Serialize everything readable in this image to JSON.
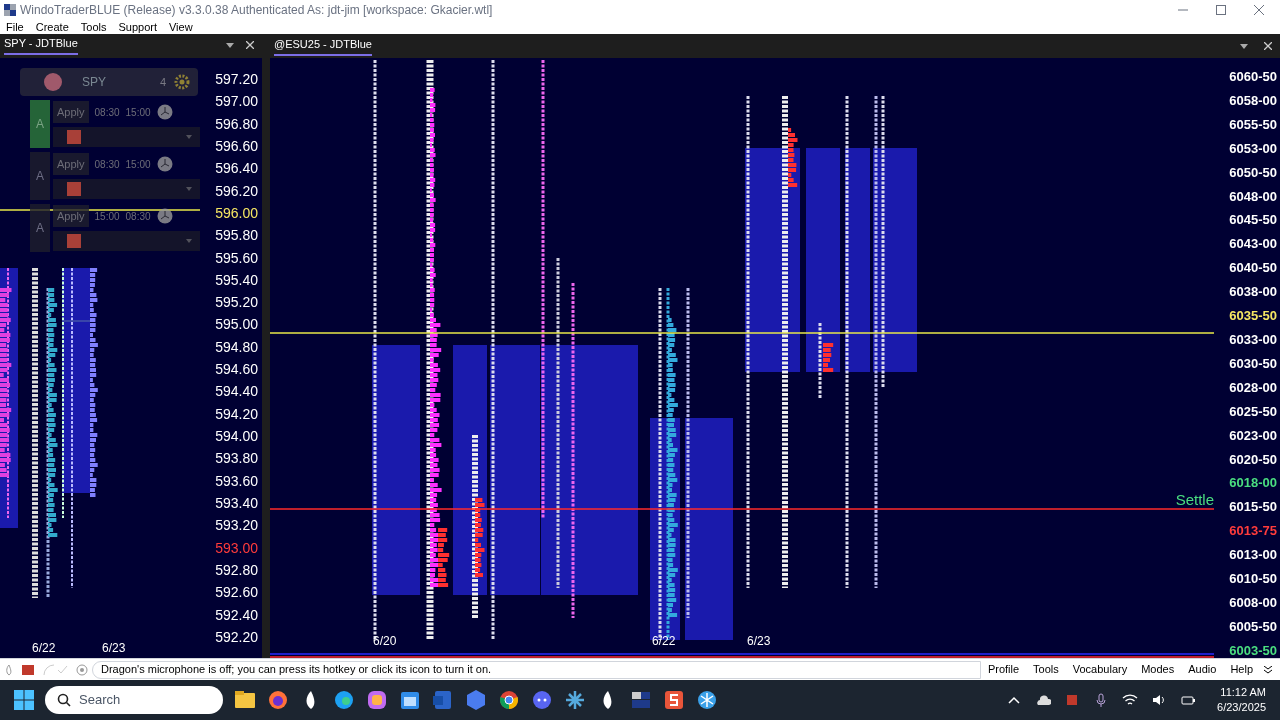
{
  "window": {
    "title": "WindoTraderBLUE (Release) v3.3.0.38 Authenticated As: jdt-jim [workspace: Gkacier.wtl]"
  },
  "menu": [
    "File",
    "Create",
    "Tools",
    "Support",
    "View"
  ],
  "left_panel": {
    "title": "SPY - JDTBlue",
    "controls": {
      "symbol": "SPY",
      "count": "4",
      "rows": [
        {
          "letter": "A",
          "selected": true,
          "apply": "Apply",
          "start": "08:30",
          "end": "15:00"
        },
        {
          "letter": "A",
          "selected": false,
          "apply": "Apply",
          "start": "08:30",
          "end": "15:00"
        },
        {
          "letter": "A",
          "selected": false,
          "apply": "Apply",
          "start": "15:00",
          "end": "08:30"
        }
      ]
    },
    "price_axis": [
      {
        "label": "597.20",
        "color": "#ffffff"
      },
      {
        "label": "597.00",
        "color": "#ffffff"
      },
      {
        "label": "596.80",
        "color": "#ffffff"
      },
      {
        "label": "596.60",
        "color": "#ffffff"
      },
      {
        "label": "596.40",
        "color": "#ffffff"
      },
      {
        "label": "596.20",
        "color": "#ffffff"
      },
      {
        "label": "596.00",
        "color": "#f5e663"
      },
      {
        "label": "595.80",
        "color": "#ffffff"
      },
      {
        "label": "595.60",
        "color": "#ffffff"
      },
      {
        "label": "595.40",
        "color": "#ffffff"
      },
      {
        "label": "595.20",
        "color": "#ffffff"
      },
      {
        "label": "595.00",
        "color": "#ffffff"
      },
      {
        "label": "594.80",
        "color": "#ffffff"
      },
      {
        "label": "594.60",
        "color": "#ffffff"
      },
      {
        "label": "594.40",
        "color": "#ffffff"
      },
      {
        "label": "594.20",
        "color": "#ffffff"
      },
      {
        "label": "594.00",
        "color": "#ffffff"
      },
      {
        "label": "593.80",
        "color": "#ffffff"
      },
      {
        "label": "593.60",
        "color": "#ffffff"
      },
      {
        "label": "593.40",
        "color": "#ffffff"
      },
      {
        "label": "593.20",
        "color": "#ffffff"
      },
      {
        "label": "593.00",
        "color": "#ff3b3b"
      },
      {
        "label": "592.80",
        "color": "#ffffff"
      },
      {
        "label": "592.60",
        "color": "#ffffff"
      },
      {
        "label": "592.40",
        "color": "#ffffff"
      },
      {
        "label": "592.20",
        "color": "#ffffff"
      }
    ],
    "dates": [
      "6/22",
      "6/23"
    ]
  },
  "right_panel": {
    "title": "@ESU25 - JDTBlue",
    "settle_label": "Settle",
    "price_axis": [
      {
        "label": "6060-50",
        "color": "#ffffff"
      },
      {
        "label": "6058-00",
        "color": "#ffffff"
      },
      {
        "label": "6055-50",
        "color": "#ffffff"
      },
      {
        "label": "6053-00",
        "color": "#ffffff"
      },
      {
        "label": "6050-50",
        "color": "#ffffff"
      },
      {
        "label": "6048-00",
        "color": "#ffffff"
      },
      {
        "label": "6045-50",
        "color": "#ffffff"
      },
      {
        "label": "6043-00",
        "color": "#ffffff"
      },
      {
        "label": "6040-50",
        "color": "#ffffff"
      },
      {
        "label": "6038-00",
        "color": "#ffffff"
      },
      {
        "label": "6035-50",
        "color": "#f5e663"
      },
      {
        "label": "6033-00",
        "color": "#ffffff"
      },
      {
        "label": "6030-50",
        "color": "#ffffff"
      },
      {
        "label": "6028-00",
        "color": "#ffffff"
      },
      {
        "label": "6025-50",
        "color": "#ffffff"
      },
      {
        "label": "6023-00",
        "color": "#ffffff"
      },
      {
        "label": "6020-50",
        "color": "#ffffff"
      },
      {
        "label": "6018-00",
        "color": "#4ade80"
      },
      {
        "label": "6015-50",
        "color": "#ffffff"
      },
      {
        "label": "6013-75",
        "color": "#ff3b3b"
      },
      {
        "label": "6013-00",
        "color": "#ffffff"
      },
      {
        "label": "6010-50",
        "color": "#ffffff"
      },
      {
        "label": "6008-00",
        "color": "#ffffff"
      },
      {
        "label": "6005-50",
        "color": "#ffffff"
      },
      {
        "label": "6003-50",
        "color": "#4ade80"
      }
    ],
    "dates": [
      "6/20",
      "6/22",
      "6/23"
    ]
  },
  "dragon_bar": {
    "message": "Dragon's microphone is off; you can press its hotkey or click its icon to turn it on.",
    "menu": [
      "Profile",
      "Tools",
      "Vocabulary",
      "Modes",
      "Audio",
      "Help"
    ]
  },
  "taskbar": {
    "search_placeholder": "Search",
    "time": "11:12 AM",
    "date": "6/23/2025"
  }
}
